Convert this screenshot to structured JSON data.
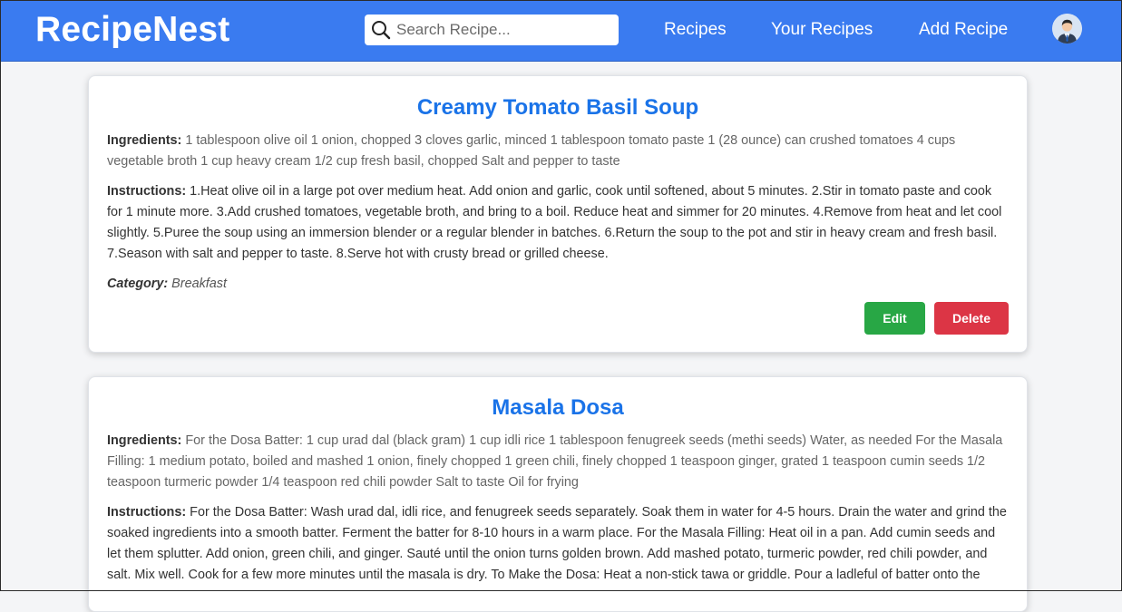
{
  "navbar": {
    "brand": "RecipeNest",
    "search_placeholder": "Search Recipe...",
    "links": [
      "Recipes",
      "Your Recipes",
      "Add Recipe"
    ],
    "avatar_icon": "user-avatar-icon",
    "background_color": "#3a7bf0"
  },
  "labels": {
    "ingredients": "Ingredients:",
    "instructions": "Instructions:",
    "category": "Category:",
    "edit": "Edit",
    "delete": "Delete"
  },
  "recipes": [
    {
      "title": "Creamy Tomato Basil Soup",
      "ingredients": "1 tablespoon olive oil 1 onion, chopped 3 cloves garlic, minced 1 tablespoon tomato paste 1 (28 ounce) can crushed tomatoes 4 cups vegetable broth 1 cup heavy cream 1/2 cup fresh basil, chopped Salt and pepper to taste",
      "instructions": "1.Heat olive oil in a large pot over medium heat. Add onion and garlic, cook until softened, about 5 minutes. 2.Stir in tomato paste and cook for 1 minute more. 3.Add crushed tomatoes, vegetable broth, and bring to a boil. Reduce heat and simmer for 20 minutes. 4.Remove from heat and let cool slightly. 5.Puree the soup using an immersion blender or a regular blender in batches. 6.Return the soup to the pot and stir in heavy cream and fresh basil. 7.Season with salt and pepper to taste. 8.Serve hot with crusty bread or grilled cheese.",
      "category": "Breakfast"
    },
    {
      "title": "Masala Dosa",
      "ingredients": "For the Dosa Batter: 1 cup urad dal (black gram) 1 cup idli rice 1 tablespoon fenugreek seeds (methi seeds) Water, as needed For the Masala Filling: 1 medium potato, boiled and mashed 1 onion, finely chopped 1 green chili, finely chopped 1 teaspoon ginger, grated 1 teaspoon cumin seeds 1/2 teaspoon turmeric powder 1/4 teaspoon red chili powder Salt to taste Oil for frying",
      "instructions": "For the Dosa Batter: Wash urad dal, idli rice, and fenugreek seeds separately. Soak them in water for 4-5 hours. Drain the water and grind the soaked ingredients into a smooth batter. Ferment the batter for 8-10 hours in a warm place. For the Masala Filling: Heat oil in a pan. Add cumin seeds and let them splutter. Add onion, green chili, and ginger. Sauté until the onion turns golden brown. Add mashed potato, turmeric powder, red chili powder, and salt. Mix well. Cook for a few more minutes until the masala is dry. To Make the Dosa: Heat a non-stick tawa or griddle. Pour a ladleful of batter onto the"
    }
  ]
}
